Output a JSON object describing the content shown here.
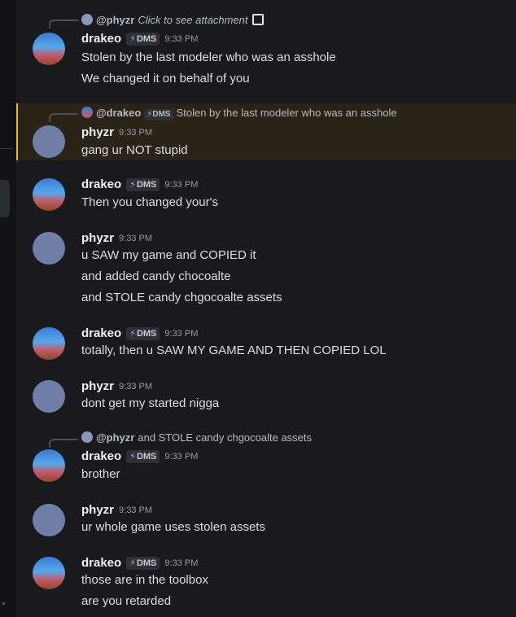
{
  "messages": [
    {
      "author": "drakeo",
      "tag": "DMS",
      "time": "9:33 PM",
      "reply": {
        "to": "@phyzr",
        "text": "Click to see attachment"
      },
      "lines": [
        "Stolen by the last modeler who was an asshole",
        "We changed it on behalf of you"
      ]
    },
    {
      "author": "phyzr",
      "time": "9:33 PM",
      "reply": {
        "to": "@drakeo",
        "tag": "DMS",
        "text": "Stolen by the last modeler who was an asshole"
      },
      "lines": [
        "gang ur NOT stupid"
      ]
    },
    {
      "author": "drakeo",
      "tag": "DMS",
      "time": "9:33 PM",
      "lines": [
        "Then you changed your's"
      ]
    },
    {
      "author": "phyzr",
      "time": "9:33 PM",
      "lines": [
        "u SAW my game and COPIED it",
        "and added candy chocoalte",
        "and STOLE candy chgocoalte assets"
      ]
    },
    {
      "author": "drakeo",
      "tag": "DMS",
      "time": "9:33 PM",
      "lines": [
        "totally, then u SAW MY GAME AND THEN COPIED LOL"
      ]
    },
    {
      "author": "phyzr",
      "time": "9:33 PM",
      "lines": [
        "dont get my started nigga"
      ]
    },
    {
      "author": "drakeo",
      "tag": "DMS",
      "time": "9:33 PM",
      "reply": {
        "to": "@phyzr",
        "text": "and STOLE candy chgocoalte assets"
      },
      "lines": [
        "brother"
      ]
    },
    {
      "author": "phyzr",
      "time": "9:33 PM",
      "lines": [
        "ur whole game uses stolen assets"
      ]
    },
    {
      "author": "drakeo",
      "tag": "DMS",
      "time": "9:33 PM",
      "lines": [
        "those are in the toolbox",
        "are you retarded"
      ]
    }
  ]
}
